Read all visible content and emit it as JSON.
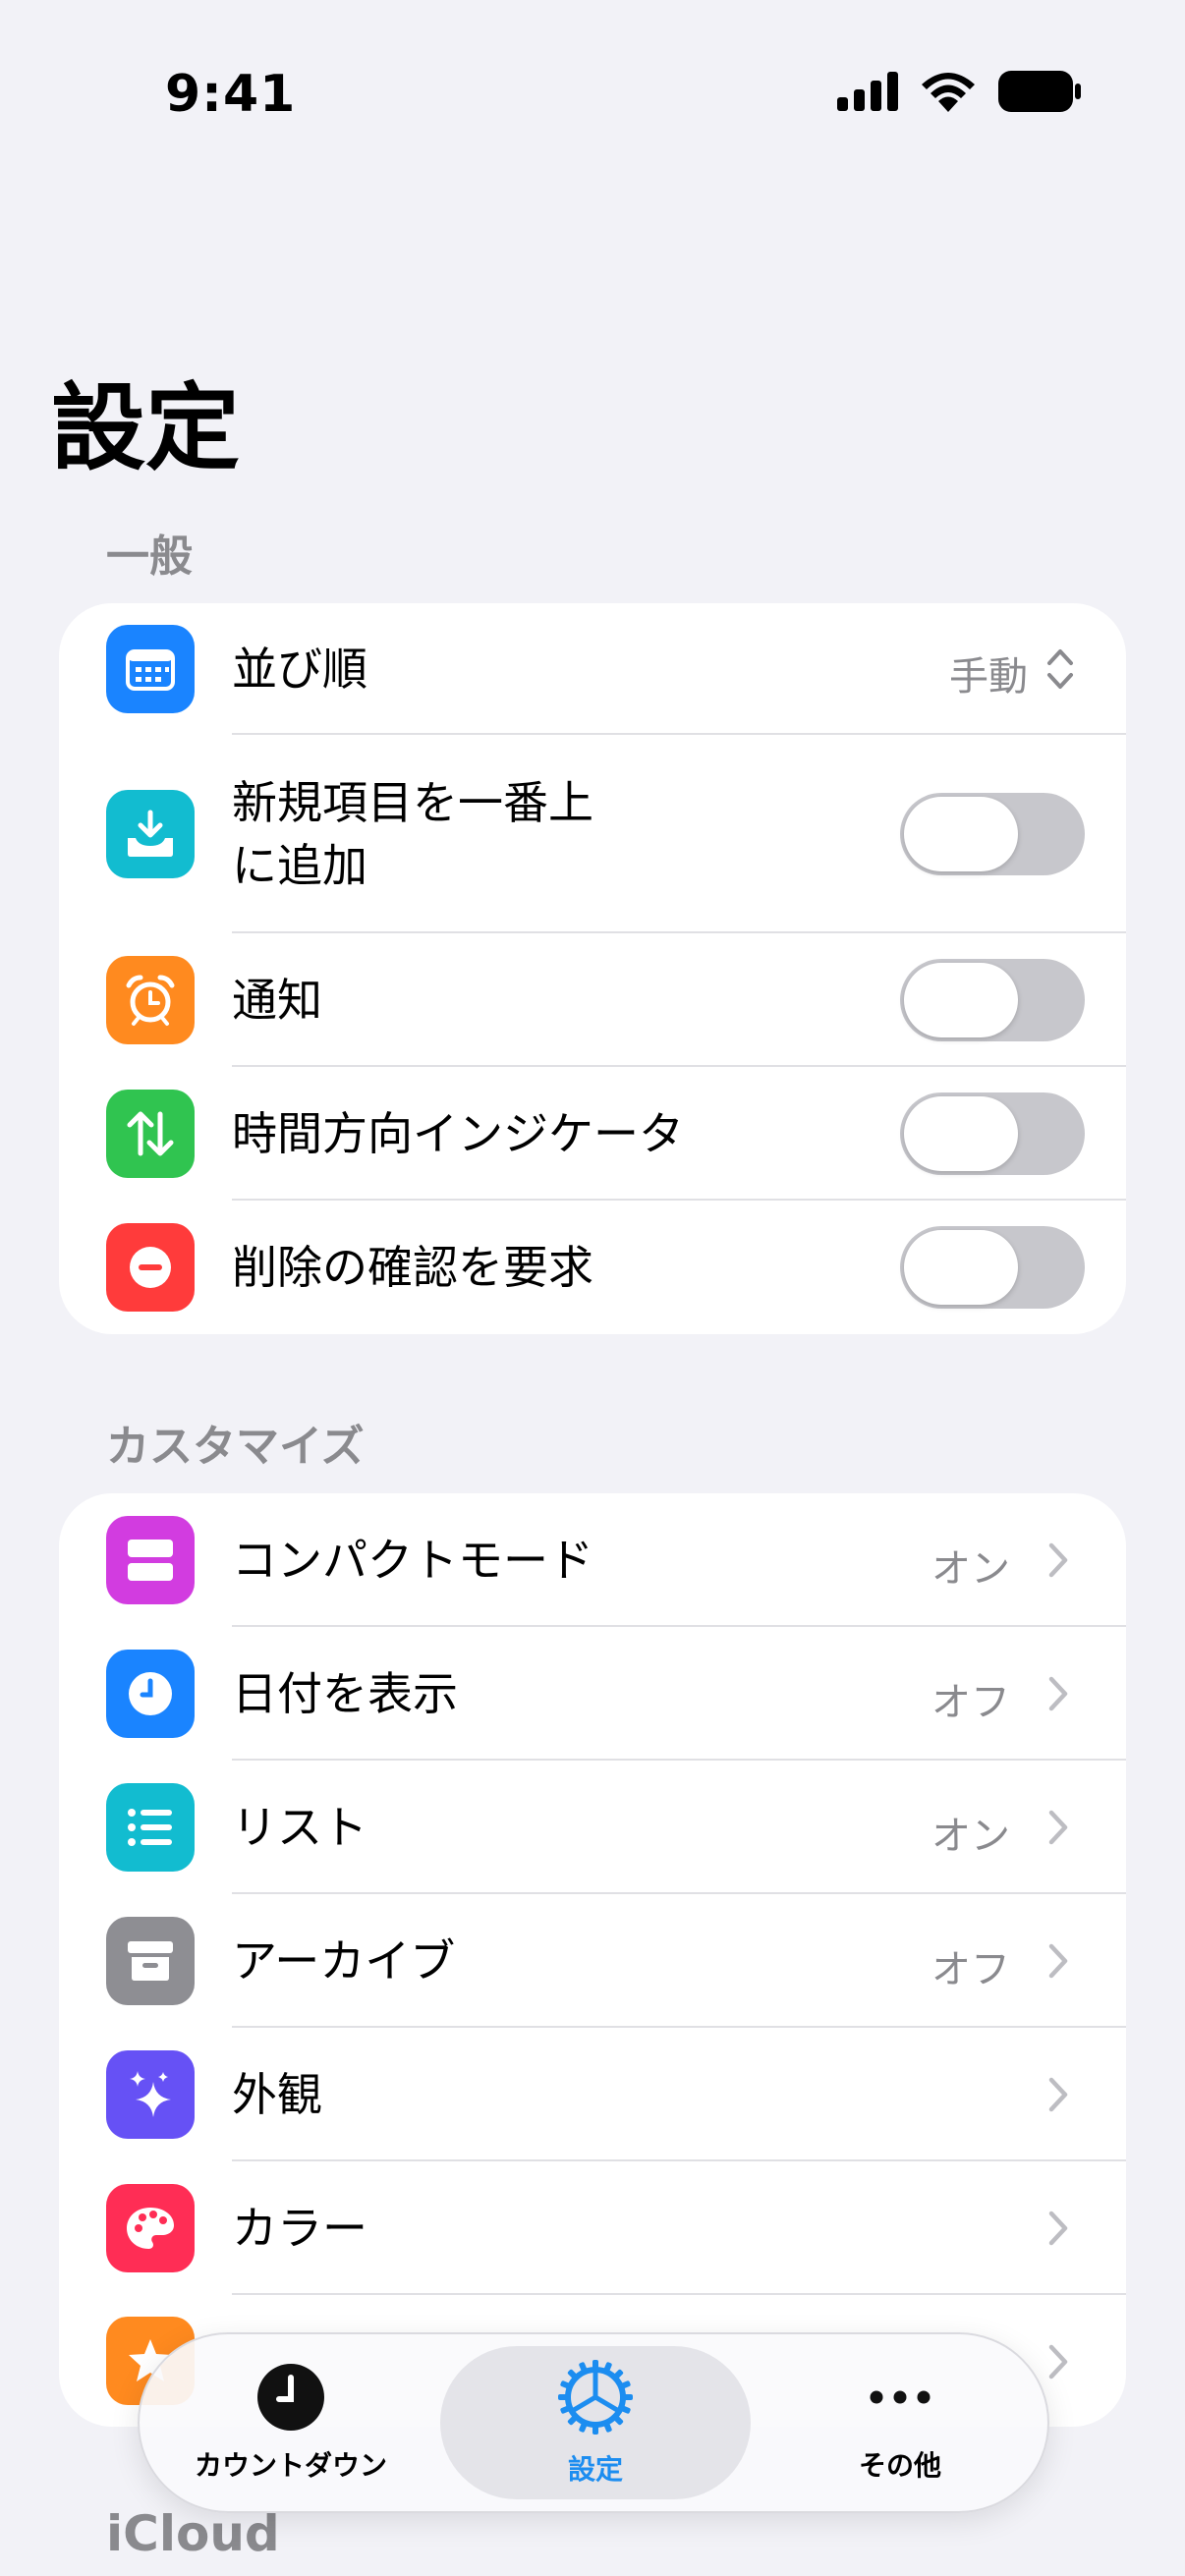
{
  "status_bar": {
    "time": "9:41"
  },
  "page_title": "設定",
  "sections": {
    "general": {
      "header": "一般",
      "sort_order": {
        "label": "並び順",
        "value": "手動"
      },
      "add_new_on_top": {
        "label_line1": "新規項目を一番上",
        "label_line2": "に追加",
        "enabled": false
      },
      "notifications": {
        "label": "通知",
        "enabled": false
      },
      "time_direction_indicator": {
        "label": "時間方向インジケータ",
        "enabled": false
      },
      "confirm_delete": {
        "label": "削除の確認を要求",
        "enabled": false
      }
    },
    "customize": {
      "header": "カスタマイズ",
      "compact_mode": {
        "label": "コンパクトモード",
        "value": "オン"
      },
      "show_date": {
        "label": "日付を表示",
        "value": "オフ"
      },
      "list": {
        "label": "リスト",
        "value": "オン"
      },
      "archive": {
        "label": "アーカイブ",
        "value": "オフ"
      },
      "appearance": {
        "label": "外観"
      },
      "color": {
        "label": "カラー"
      }
    },
    "icloud": {
      "header": "iCloud"
    }
  },
  "tab_bar": {
    "countdown": "カウントダウン",
    "settings": "設定",
    "more": "その他"
  },
  "colors": {
    "background": "#F2F2F7",
    "accent": "#1C8DF0",
    "icon_blue": "#1A84FF",
    "icon_teal": "#12BCD0",
    "icon_orange": "#FF8A1F",
    "icon_green": "#30C450",
    "icon_red": "#FF3B3B",
    "icon_magenta": "#D23CE0",
    "icon_gray": "#8E8E93",
    "icon_indigo": "#6651F5",
    "icon_pink": "#FF2D55"
  }
}
